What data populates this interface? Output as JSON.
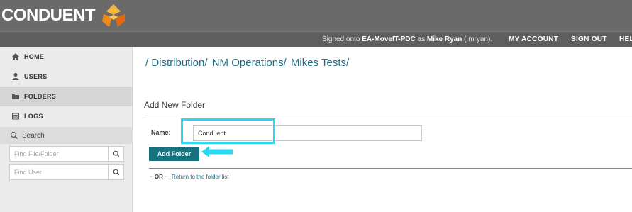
{
  "header": {
    "logo_text": "CONDUENT",
    "signed_prefix": "Signed onto ",
    "signed_org": "EA-MoveIT-PDC",
    "signed_mid": " as ",
    "signed_user": "Mike Ryan",
    "signed_suffix": " ( mryan).",
    "links": [
      "MY ACCOUNT",
      "SIGN OUT",
      "HEL"
    ]
  },
  "sidebar": {
    "items": [
      {
        "label": "HOME",
        "icon": "home-icon"
      },
      {
        "label": "USERS",
        "icon": "user-icon"
      },
      {
        "label": "FOLDERS",
        "icon": "folder-icon"
      },
      {
        "label": "LOGS",
        "icon": "list-icon"
      }
    ],
    "search_label": "Search",
    "find_file_placeholder": "Find File/Folder",
    "find_user_placeholder": "Find User"
  },
  "main": {
    "breadcrumb": [
      "/ Distribution/",
      "NM Operations/",
      "Mikes Tests/"
    ],
    "section_title": "Add New Folder",
    "name_label": "Name:",
    "name_value": "Conduent",
    "add_button": "Add Folder",
    "or_text": "~ OR ~",
    "return_link": "Return to the folder list"
  },
  "colors": {
    "header_bg": "#6a6a6a",
    "link_teal": "#1f6d84",
    "button_teal": "#17727f",
    "highlight_cyan": "#29d9f0",
    "logo_orange": "#f39a1e"
  }
}
